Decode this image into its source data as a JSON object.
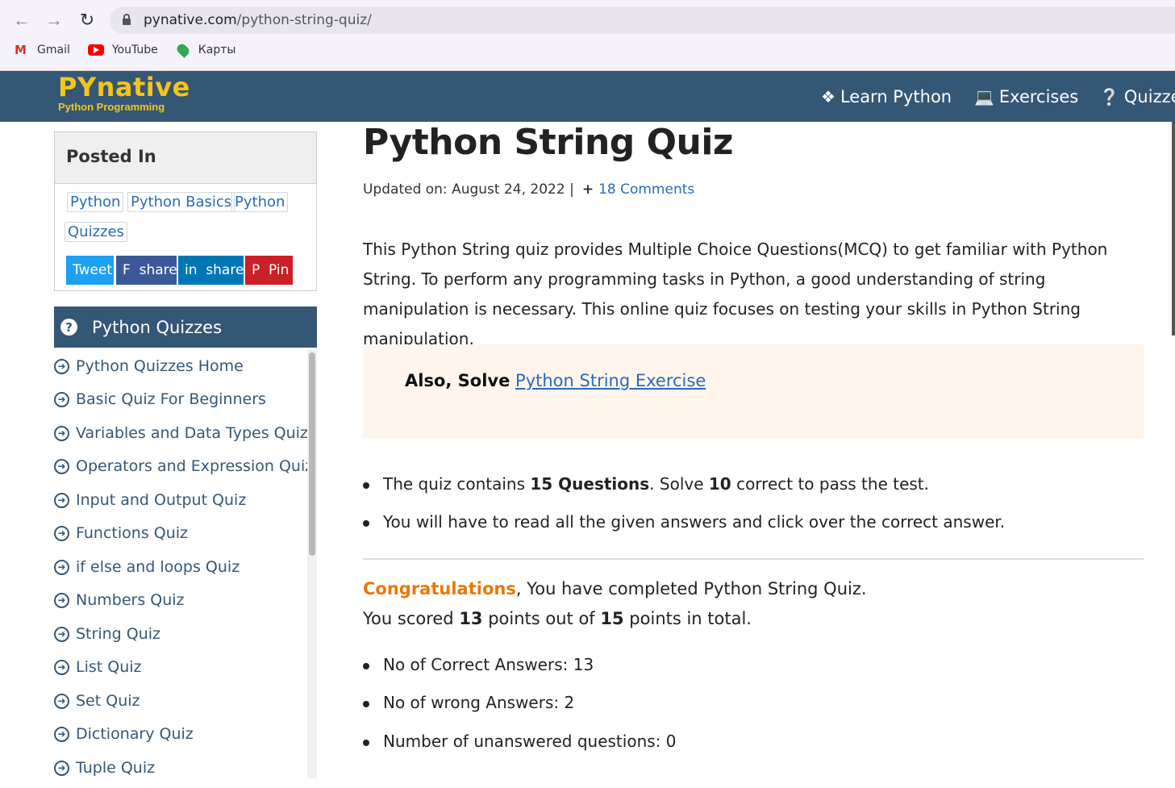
{
  "browser": {
    "url_host": "pynative.com",
    "url_path": "/python-string-quiz/",
    "bookmarks": [
      {
        "label": "Gmail",
        "icon": "gmail-icon"
      },
      {
        "label": "YouTube",
        "icon": "youtube-icon"
      },
      {
        "label": "Карты",
        "icon": "maps-icon"
      }
    ]
  },
  "header": {
    "logo_main": "PYnative",
    "logo_sub": "Python Programming",
    "nav": [
      {
        "label": "Learn Python",
        "icon": "python-icon"
      },
      {
        "label": "Exercises",
        "icon": "laptop-icon"
      },
      {
        "label": "Quizze",
        "icon": "question-icon"
      }
    ]
  },
  "sidebar": {
    "posted_in_title": "Posted In",
    "tags": [
      "Python",
      "Python Basics",
      "Python",
      "Quizzes"
    ],
    "share": {
      "tweet": "Tweet",
      "facebook": "F  share",
      "linkedin": "in  share",
      "pinterest": "P  Pin"
    },
    "quizzes_title": "Python Quizzes",
    "quizzes": [
      "Python Quizzes Home",
      "Basic Quiz For Beginners",
      "Variables and Data Types Quiz",
      "Operators and Expression Quiz",
      "Input and Output Quiz",
      "Functions Quiz",
      "if else and loops Quiz",
      "Numbers Quiz",
      "String Quiz",
      "List Quiz",
      "Set Quiz",
      "Dictionary Quiz",
      "Tuple Quiz"
    ]
  },
  "main": {
    "title": "Python String Quiz",
    "updated": "Updated on: August 24, 2022 |",
    "comments": "18 Comments",
    "intro": "This Python String quiz provides Multiple Choice Questions(MCQ) to get familiar with Python String. To perform any programming tasks in Python, a good understanding of string manipulation is necessary. This online quiz focuses on testing your skills in Python String manipulation.",
    "also_prefix": "Also, Solve",
    "also_link": "Python String Exercise",
    "bullets": {
      "b1_pre": "The quiz contains ",
      "b1_bold1": "15 Questions",
      "b1_mid": ". Solve ",
      "b1_bold2": "10",
      "b1_post": " correct to pass the test.",
      "b2": "You will have to read all the given answers and click over the correct answer."
    },
    "result": {
      "congrats": "Congratulations",
      "completed": ", You have completed Python String Quiz.",
      "scored_pre": "You scored ",
      "score": "13",
      "scored_mid": " points out of ",
      "total": "15",
      "scored_post": " points in total."
    },
    "stats": [
      "No of Correct Answers: 13",
      "No of wrong Answers: 2",
      "Number of unanswered questions: 0"
    ]
  },
  "colors": {
    "header_bg": "#355776",
    "logo": "#f5c518",
    "congrats": "#e8780a",
    "link": "#2a6bb5",
    "tweet": "#1da1f2",
    "facebook": "#3b5998",
    "linkedin": "#0077b5",
    "pinterest": "#cb2027"
  }
}
